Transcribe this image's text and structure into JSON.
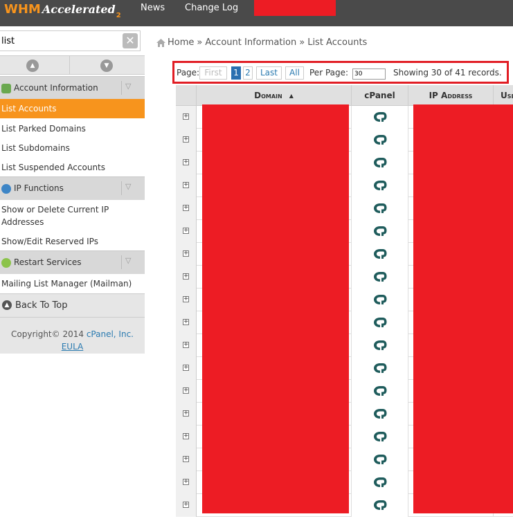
{
  "topbar": {
    "logo_main": "WHM",
    "logo_accent": "Accelerated",
    "logo_sub": "2",
    "nav_news": "News",
    "nav_changelog": "Change Log"
  },
  "search": {
    "value": "list",
    "clear_icon": "close-icon"
  },
  "sidebar": {
    "sections": [
      {
        "label": "Account Information",
        "icon": "account-info-icon",
        "color": "#6aa84f"
      },
      {
        "label": "IP Functions",
        "icon": "globe-icon",
        "color": "#3d85c6"
      },
      {
        "label": "Restart Services",
        "icon": "restart-icon",
        "color": "#8bc34a"
      }
    ],
    "items": {
      "list_accounts": "List Accounts",
      "list_parked": "List Parked Domains",
      "list_subdomains": "List Subdomains",
      "list_suspended": "List Suspended Accounts",
      "show_delete_ip": "Show or Delete Current IP Addresses",
      "show_edit_reserved": "Show/Edit Reserved IPs",
      "mailing_list": "Mailing List Manager (Mailman)"
    },
    "back_to_top": "Back To Top",
    "footer": {
      "copyright": "Copyright© 2014",
      "company": "cPanel, Inc.",
      "eula": "EULA"
    }
  },
  "breadcrumb": {
    "home": "Home",
    "sep": "»",
    "level1": "Account Information",
    "level2": "List Accounts"
  },
  "pager": {
    "page_label": "Page:",
    "first": "First",
    "pages": [
      "1",
      "2"
    ],
    "last": "Last",
    "all": "All",
    "per_page_label": "Per Page:",
    "per_page_value": "30",
    "showing": "Showing 30 of 41 records."
  },
  "table": {
    "columns": {
      "domain": "Domain",
      "cpanel": "cPanel",
      "ip": "IP Address",
      "user": "Use"
    },
    "row_count": 18
  },
  "colors": {
    "accent": "#f7941d",
    "topbar": "#4a4a4a",
    "link": "#2a7ab0",
    "redaction": "#ed1c24"
  }
}
